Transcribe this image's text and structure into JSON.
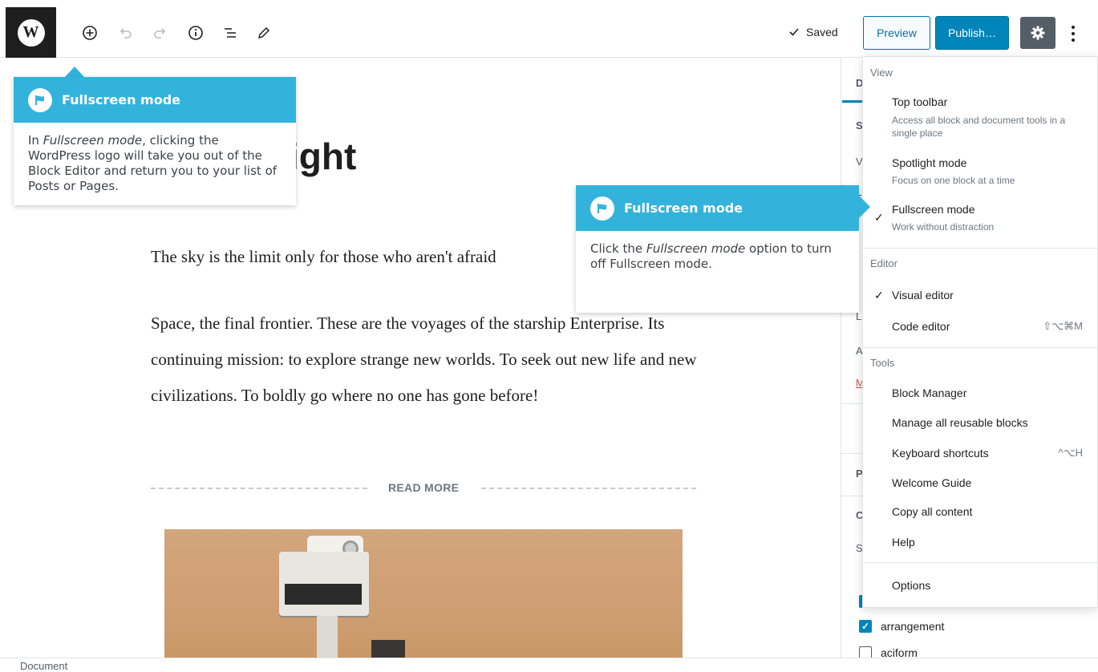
{
  "toolbar": {
    "saved_label": "Saved",
    "preview_label": "Preview",
    "publish_label": "Publish…"
  },
  "editor": {
    "title_fragment": "ight",
    "paragraph1": "The sky is the limit only for those who aren't afraid",
    "paragraph2": "Space, the final frontier. These are the voyages of the starship Enterprise. Its continuing mission: to explore strange new worlds. To seek out new life and new civilizations. To boldly go where no one has gone before!",
    "read_more": "READ MORE"
  },
  "sidebar": {
    "letters": [
      "D",
      "S",
      "V",
      "F",
      "L",
      "A",
      "M",
      "P",
      "C",
      "S"
    ],
    "checkboxes": [
      {
        "label": "arrangement",
        "checked": true
      },
      {
        "label": "aciform",
        "checked": false
      }
    ]
  },
  "menu": {
    "view_heading": "View",
    "top_toolbar": "Top toolbar",
    "top_toolbar_desc": "Access all block and document tools in a single place",
    "spotlight": "Spotlight mode",
    "spotlight_desc": "Focus on one block at a time",
    "fullscreen": "Fullscreen mode",
    "fullscreen_desc": "Work without distraction",
    "editor_heading": "Editor",
    "visual_editor": "Visual editor",
    "code_editor": "Code editor",
    "code_editor_shortcut": "⇧⌥⌘M",
    "tools_heading": "Tools",
    "block_manager": "Block Manager",
    "reusable_blocks": "Manage all reusable blocks",
    "keyboard_shortcuts": "Keyboard shortcuts",
    "keyboard_shortcuts_shortcut": "^⌥H",
    "welcome_guide": "Welcome Guide",
    "copy_all": "Copy all content",
    "help": "Help",
    "options": "Options"
  },
  "tooltip1": {
    "title": "Fullscreen mode",
    "body_pre": "In ",
    "body_em": "Fullscreen mode",
    "body_post": ", clicking the WordPress logo will take you out of the Block Editor and return you to your list of Posts or Pages."
  },
  "tooltip2": {
    "title": "Fullscreen mode",
    "body_pre": "Click the ",
    "body_em": "Fullscreen mode",
    "body_post": " option to turn off Fullscreen mode."
  },
  "footer": {
    "breadcrumb": "Document"
  },
  "colors": {
    "accent": "#0085ba",
    "tooltip_header": "#33b3db"
  }
}
